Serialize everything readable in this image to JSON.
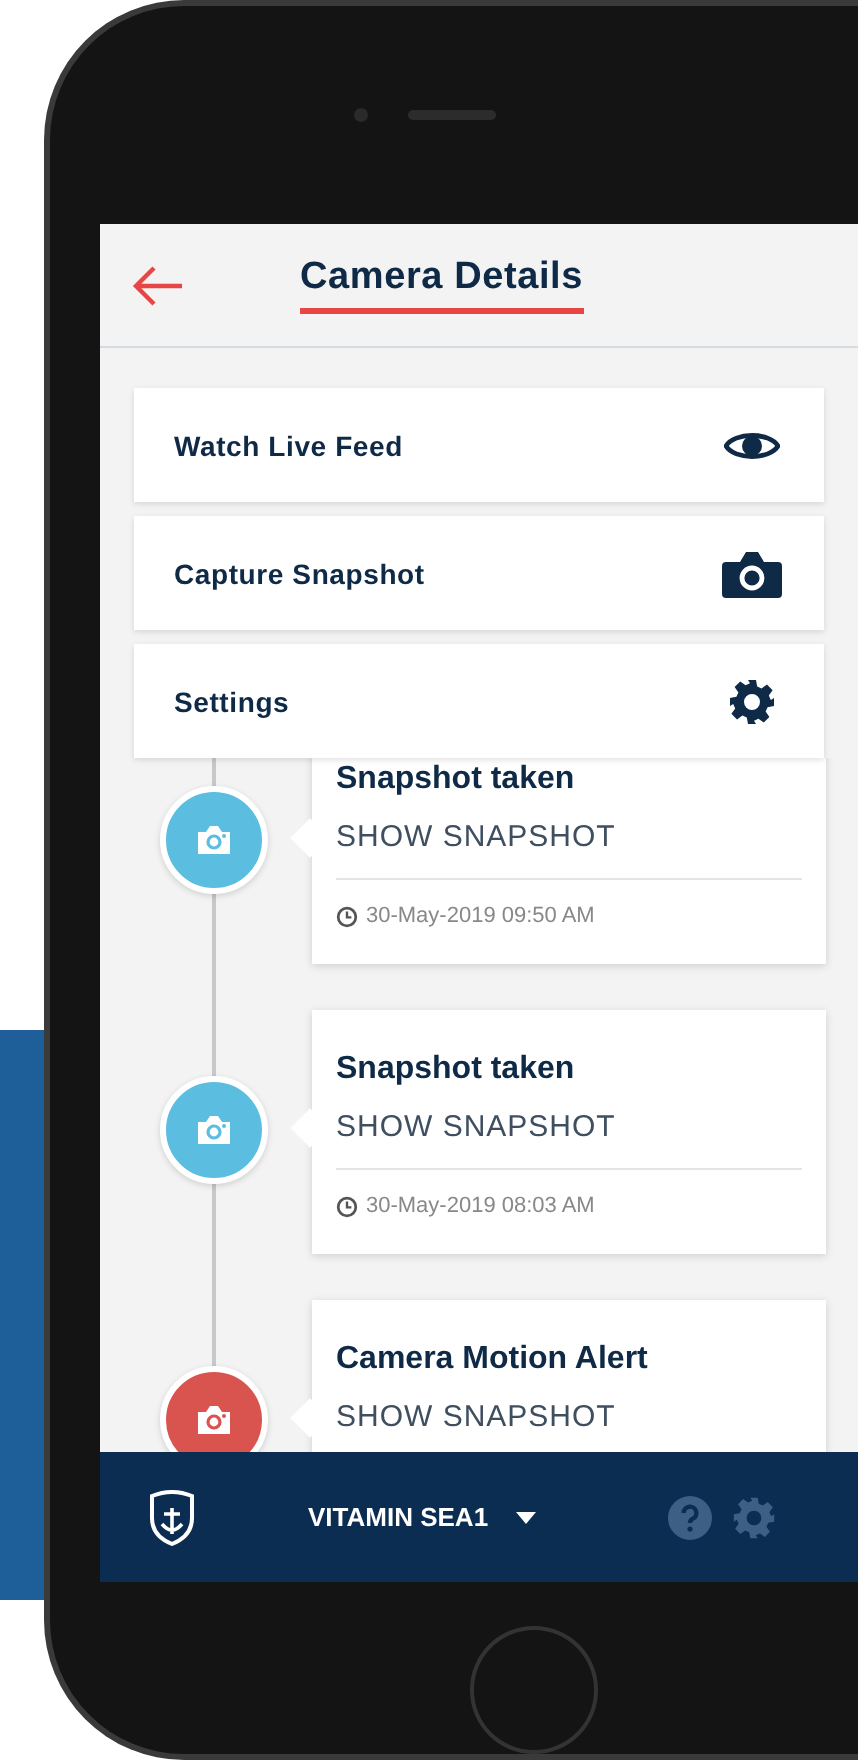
{
  "header": {
    "title": "Camera Details"
  },
  "menu": [
    {
      "label": "Watch Live Feed",
      "kind": "eye"
    },
    {
      "label": "Capture Snapshot",
      "kind": "camera"
    },
    {
      "label": "Settings",
      "kind": "gear"
    }
  ],
  "timeline": [
    {
      "title": "Snapshot taken",
      "action": "SHOW SNAPSHOT",
      "time": "30-May-2019 09:50 AM",
      "color": "#5bbde0"
    },
    {
      "title": "Snapshot taken",
      "action": "SHOW SNAPSHOT",
      "time": "30-May-2019 08:03 AM",
      "color": "#5bbde0"
    },
    {
      "title": "Camera Motion Alert",
      "action": "SHOW SNAPSHOT",
      "color": "#d9534f"
    }
  ],
  "bottom_bar": {
    "vessel": "VITAMIN SEA1"
  }
}
